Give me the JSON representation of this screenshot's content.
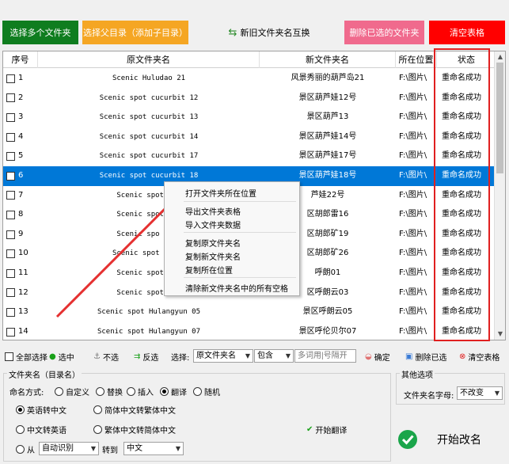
{
  "toolbar": {
    "select_multiple": "选择多个文件夹",
    "select_parent": "选择父目录（添加子目录）",
    "swap_names": "新旧文件夹名互换",
    "delete_selected": "删除已选的文件夹",
    "clear_table": "清空表格"
  },
  "table": {
    "headers": [
      "序号",
      "原文件夹名",
      "新文件夹名",
      "所在位置",
      "状态"
    ],
    "rows": [
      {
        "no": "1",
        "old": "Scenic Huludao 21",
        "new": "风景秀丽的葫芦岛21",
        "loc": "F:\\图片\\",
        "status": "重命名成功"
      },
      {
        "no": "2",
        "old": "Scenic spot cucurbit 12",
        "new": "景区葫芦娃12号",
        "loc": "F:\\图片\\",
        "status": "重命名成功"
      },
      {
        "no": "3",
        "old": "Scenic spot cucurbit 13",
        "new": "景区葫芦13",
        "loc": "F:\\图片\\",
        "status": "重命名成功"
      },
      {
        "no": "4",
        "old": "Scenic spot cucurbit 14",
        "new": "景区葫芦娃14号",
        "loc": "F:\\图片\\",
        "status": "重命名成功"
      },
      {
        "no": "5",
        "old": "Scenic spot cucurbit 17",
        "new": "景区葫芦娃17号",
        "loc": "F:\\图片\\",
        "status": "重命名成功"
      },
      {
        "no": "6",
        "old": "Scenic spot cucurbit 18",
        "new": "景区葫芦娃18号",
        "loc": "F:\\图片\\",
        "status": "重命名成功"
      },
      {
        "no": "7",
        "old": "Scenic spot cuc",
        "new": "芦娃22号",
        "loc": "F:\\图片\\",
        "status": "重命名成功"
      },
      {
        "no": "8",
        "old": "Scenic spot Hul",
        "new": "区胡郎雷16",
        "loc": "F:\\图片\\",
        "status": "重命名成功"
      },
      {
        "no": "9",
        "old": "Scenic spo Hula",
        "new": "区胡郎矿19",
        "loc": "F:\\图片\\",
        "status": "重命名成功"
      },
      {
        "no": "10",
        "old": "Scenic spot Hulan",
        "new": "区胡郎矿26",
        "loc": "F:\\图片\\",
        "status": "重命名成功"
      },
      {
        "no": "11",
        "old": "Scenic spot Hul",
        "new": "呼朗01",
        "loc": "F:\\图片\\",
        "status": "重命名成功"
      },
      {
        "no": "12",
        "old": "Scenic spot Hul",
        "new": "区呼朗云03",
        "loc": "F:\\图片\\",
        "status": "重命名成功"
      },
      {
        "no": "13",
        "old": "Scenic spot Hulangyun 05",
        "new": "景区呼朗云05",
        "loc": "F:\\图片\\",
        "status": "重命名成功"
      },
      {
        "no": "14",
        "old": "Scenic spot Hulangyun 07",
        "new": "景区呼伦贝尔07",
        "loc": "F:\\图片\\",
        "status": "重命名成功"
      }
    ]
  },
  "context_menu": {
    "items": [
      "打开文件夹所在位置",
      "导出文件夹表格",
      "导入文件夹数据",
      "复制原文件夹名",
      "复制新文件夹名",
      "复制所在位置",
      "清除新文件夹名中的所有空格"
    ]
  },
  "selection_bar": {
    "select_all": "全部选择",
    "check": "选中",
    "uncheck": "不选",
    "invert": "反选",
    "select_label": "选择:",
    "field": "原文件夹名",
    "op": "包含",
    "search_placeholder": "多词用|号隔开",
    "confirm": "确定",
    "delete_checked": "删除已选",
    "clear_table": "清空表格"
  },
  "rename": {
    "group_title": "文件夹名（目录名）",
    "mode_label": "命名方式:",
    "modes": [
      "自定义",
      "替换",
      "插入",
      "翻译",
      "随机"
    ],
    "opt_en2zh": "英语转中文",
    "opt_s2t": "简体中文转繁体中文",
    "opt_zh2en": "中文转英语",
    "opt_t2s": "繁体中文转简体中文",
    "start_translate": "开始翻译",
    "from_label": "从",
    "from_value": "自动识别",
    "to_label": "转到",
    "to_value": "中文"
  },
  "other": {
    "group_title": "其他选项",
    "case_label": "文件夹名字母:",
    "case_value": "不改变"
  },
  "start_button": "开始改名"
}
